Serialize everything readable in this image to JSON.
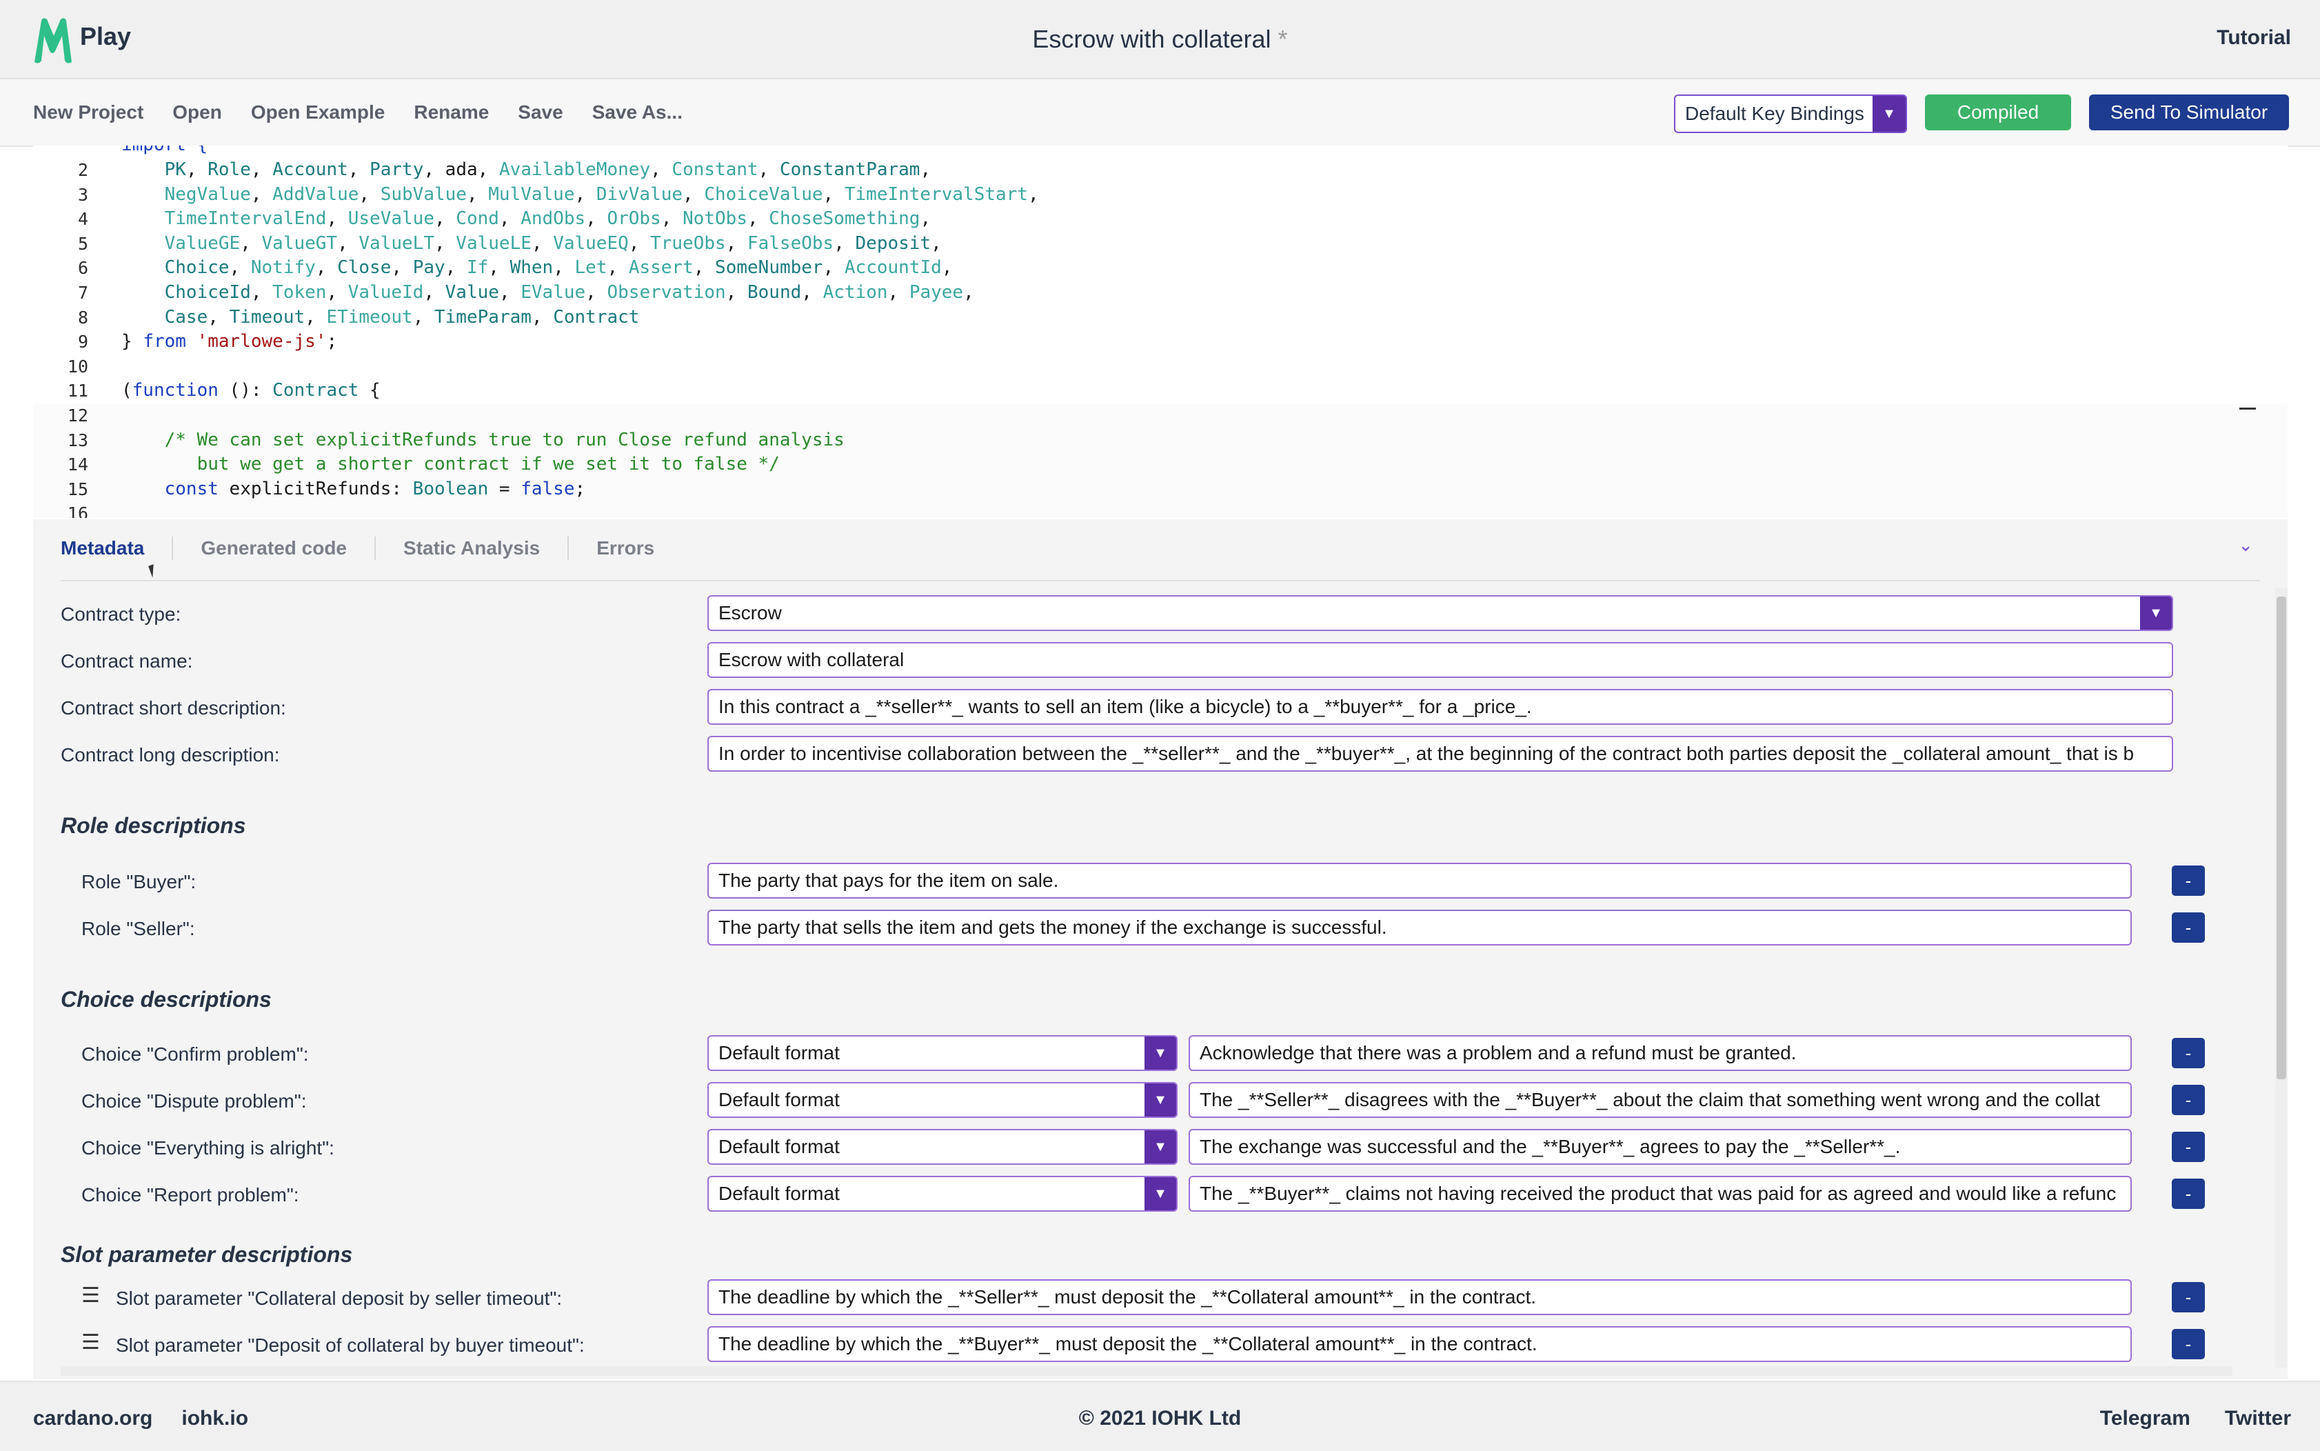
{
  "app": {
    "logo_text": "Play",
    "title": "Escrow with collateral",
    "dirty_marker": "*",
    "tutorial": "Tutorial"
  },
  "toolbar": {
    "menu": [
      "New Project",
      "Open",
      "Open Example",
      "Rename",
      "Save",
      "Save As..."
    ],
    "key_bindings": "Default Key Bindings",
    "compiled": "Compiled",
    "send": "Send To Simulator"
  },
  "editor": {
    "lines": [
      {
        "n": "2",
        "tokens": [
          [
            "pl",
            "    "
          ],
          [
            "ty",
            "PK"
          ],
          [
            "pl",
            ", "
          ],
          [
            "ty",
            "Role"
          ],
          [
            "pl",
            ", "
          ],
          [
            "ty",
            "Account"
          ],
          [
            "pl",
            ", "
          ],
          [
            "ty",
            "Party"
          ],
          [
            "pl",
            ", "
          ],
          [
            "pl",
            "ada"
          ],
          [
            "pl",
            ", "
          ],
          [
            "dim",
            "AvailableMoney"
          ],
          [
            "pl",
            ", "
          ],
          [
            "dim",
            "Constant"
          ],
          [
            "pl",
            ", "
          ],
          [
            "ty",
            "ConstantParam"
          ],
          [
            "pl",
            ","
          ]
        ]
      },
      {
        "n": "3",
        "tokens": [
          [
            "pl",
            "    "
          ],
          [
            "dim",
            "NegValue"
          ],
          [
            "pl",
            ", "
          ],
          [
            "dim",
            "AddValue"
          ],
          [
            "pl",
            ", "
          ],
          [
            "dim",
            "SubValue"
          ],
          [
            "pl",
            ", "
          ],
          [
            "dim",
            "MulValue"
          ],
          [
            "pl",
            ", "
          ],
          [
            "dim",
            "DivValue"
          ],
          [
            "pl",
            ", "
          ],
          [
            "dim",
            "ChoiceValue"
          ],
          [
            "pl",
            ", "
          ],
          [
            "dim",
            "TimeIntervalStart"
          ],
          [
            "pl",
            ","
          ]
        ]
      },
      {
        "n": "4",
        "tokens": [
          [
            "pl",
            "    "
          ],
          [
            "dim",
            "TimeIntervalEnd"
          ],
          [
            "pl",
            ", "
          ],
          [
            "dim",
            "UseValue"
          ],
          [
            "pl",
            ", "
          ],
          [
            "dim",
            "Cond"
          ],
          [
            "pl",
            ", "
          ],
          [
            "dim",
            "AndObs"
          ],
          [
            "pl",
            ", "
          ],
          [
            "dim",
            "OrObs"
          ],
          [
            "pl",
            ", "
          ],
          [
            "dim",
            "NotObs"
          ],
          [
            "pl",
            ", "
          ],
          [
            "dim",
            "ChoseSomething"
          ],
          [
            "pl",
            ","
          ]
        ]
      },
      {
        "n": "5",
        "tokens": [
          [
            "pl",
            "    "
          ],
          [
            "dim",
            "ValueGE"
          ],
          [
            "pl",
            ", "
          ],
          [
            "dim",
            "ValueGT"
          ],
          [
            "pl",
            ", "
          ],
          [
            "dim",
            "ValueLT"
          ],
          [
            "pl",
            ", "
          ],
          [
            "dim",
            "ValueLE"
          ],
          [
            "pl",
            ", "
          ],
          [
            "dim",
            "ValueEQ"
          ],
          [
            "pl",
            ", "
          ],
          [
            "dim",
            "TrueObs"
          ],
          [
            "pl",
            ", "
          ],
          [
            "dim",
            "FalseObs"
          ],
          [
            "pl",
            ", "
          ],
          [
            "ty",
            "Deposit"
          ],
          [
            "pl",
            ","
          ]
        ]
      },
      {
        "n": "6",
        "tokens": [
          [
            "pl",
            "    "
          ],
          [
            "ty",
            "Choice"
          ],
          [
            "pl",
            ", "
          ],
          [
            "dim",
            "Notify"
          ],
          [
            "pl",
            ", "
          ],
          [
            "ty",
            "Close"
          ],
          [
            "pl",
            ", "
          ],
          [
            "ty",
            "Pay"
          ],
          [
            "pl",
            ", "
          ],
          [
            "dim",
            "If"
          ],
          [
            "pl",
            ", "
          ],
          [
            "ty",
            "When"
          ],
          [
            "pl",
            ", "
          ],
          [
            "dim",
            "Let"
          ],
          [
            "pl",
            ", "
          ],
          [
            "dim",
            "Assert"
          ],
          [
            "pl",
            ", "
          ],
          [
            "ty",
            "SomeNumber"
          ],
          [
            "pl",
            ", "
          ],
          [
            "dim",
            "AccountId"
          ],
          [
            "pl",
            ","
          ]
        ]
      },
      {
        "n": "7",
        "tokens": [
          [
            "pl",
            "    "
          ],
          [
            "ty",
            "ChoiceId"
          ],
          [
            "pl",
            ", "
          ],
          [
            "dim",
            "Token"
          ],
          [
            "pl",
            ", "
          ],
          [
            "dim",
            "ValueId"
          ],
          [
            "pl",
            ", "
          ],
          [
            "ty",
            "Value"
          ],
          [
            "pl",
            ", "
          ],
          [
            "dim",
            "EValue"
          ],
          [
            "pl",
            ", "
          ],
          [
            "dim",
            "Observation"
          ],
          [
            "pl",
            ", "
          ],
          [
            "ty",
            "Bound"
          ],
          [
            "pl",
            ", "
          ],
          [
            "dim",
            "Action"
          ],
          [
            "pl",
            ", "
          ],
          [
            "dim",
            "Payee"
          ],
          [
            "pl",
            ","
          ]
        ]
      },
      {
        "n": "8",
        "tokens": [
          [
            "pl",
            "    "
          ],
          [
            "ty",
            "Case"
          ],
          [
            "pl",
            ", "
          ],
          [
            "ty",
            "Timeout"
          ],
          [
            "pl",
            ", "
          ],
          [
            "dim",
            "ETimeout"
          ],
          [
            "pl",
            ", "
          ],
          [
            "ty",
            "TimeParam"
          ],
          [
            "pl",
            ", "
          ],
          [
            "ty",
            "Contract"
          ]
        ]
      },
      {
        "n": "9",
        "tokens": [
          [
            "pl",
            "} "
          ],
          [
            "kw",
            "from"
          ],
          [
            "pl",
            " "
          ],
          [
            "str",
            "'marlowe-js'"
          ],
          [
            "pl",
            ";"
          ]
        ]
      },
      {
        "n": "10",
        "tokens": []
      },
      {
        "n": "11",
        "tokens": [
          [
            "pl",
            "("
          ],
          [
            "kw",
            "function"
          ],
          [
            "pl",
            " (): "
          ],
          [
            "ty",
            "Contract"
          ],
          [
            "pl",
            " {"
          ]
        ]
      },
      {
        "n": "12",
        "tokens": [],
        "hl": true
      },
      {
        "n": "13",
        "tokens": [
          [
            "pl",
            "    "
          ],
          [
            "com",
            "/* We can set explicitRefunds true to run Close refund analysis"
          ]
        ],
        "hl": true
      },
      {
        "n": "14",
        "tokens": [
          [
            "com",
            "       but we get a shorter contract if we set it to false */"
          ]
        ],
        "hl": true
      },
      {
        "n": "15",
        "tokens": [
          [
            "pl",
            "    "
          ],
          [
            "kw",
            "const"
          ],
          [
            "pl",
            " explicitRefunds: "
          ],
          [
            "ty",
            "Boolean"
          ],
          [
            "pl",
            " = "
          ],
          [
            "kw",
            "false"
          ],
          [
            "pl",
            ";"
          ]
        ],
        "hl": true
      },
      {
        "n": "16",
        "tokens": [],
        "hl": true
      }
    ]
  },
  "tabs": [
    "Metadata",
    "Generated code",
    "Static Analysis",
    "Errors"
  ],
  "metadata": {
    "contract_type_label": "Contract type:",
    "contract_type": "Escrow",
    "contract_name_label": "Contract name:",
    "contract_name": "Escrow with collateral",
    "short_desc_label": "Contract short description:",
    "short_desc": "In this contract a _**seller**_ wants to sell an item (like a bicycle) to a _**buyer**_ for a _price_.",
    "long_desc_label": "Contract long description:",
    "long_desc": "In order to incentivise collaboration between the _**seller**_ and the _**buyer**_, at the beginning of the contract both parties deposit the _collateral amount_ that is b",
    "role_section": "Role descriptions",
    "roles": [
      {
        "label": "Role \"Buyer\":",
        "value": "The party that pays for the item on sale."
      },
      {
        "label": "Role \"Seller\":",
        "value": "The party that sells the item and gets the money if the exchange is successful."
      }
    ],
    "choice_section": "Choice descriptions",
    "choices": [
      {
        "label": "Choice \"Confirm problem\":",
        "format": "Default format",
        "value": "Acknowledge that there was a problem and a refund must be granted."
      },
      {
        "label": "Choice \"Dispute problem\":",
        "format": "Default format",
        "value": "The _**Seller**_ disagrees with the _**Buyer**_ about the claim that something went wrong and the collat"
      },
      {
        "label": "Choice \"Everything is alright\":",
        "format": "Default format",
        "value": "The exchange was successful and the _**Buyer**_ agrees to pay the _**Seller**_."
      },
      {
        "label": "Choice \"Report problem\":",
        "format": "Default format",
        "value": "The _**Buyer**_ claims not having received the product that was paid for as agreed and would like a refunc"
      }
    ],
    "slot_section": "Slot parameter descriptions",
    "slots": [
      {
        "label": "Slot parameter \"Collateral deposit by seller timeout\":",
        "value": "The deadline by which the _**Seller**_ must deposit the _**Collateral amount**_ in the contract."
      },
      {
        "label": "Slot parameter \"Deposit of collateral by buyer timeout\":",
        "value": "The deadline by which the _**Buyer**_ must deposit the _**Collateral amount**_ in the contract."
      }
    ],
    "remove_label": "-"
  },
  "footer": {
    "left": [
      "cardano.org",
      "iohk.io"
    ],
    "copyright": "© 2021 IOHK Ltd",
    "right": [
      "Telegram",
      "Twitter"
    ]
  },
  "colors": {
    "accent": "#5b2ea6",
    "primary": "#1d3b8f",
    "success": "#3bb368",
    "field_border": "#9b6fd8"
  },
  "icons": [
    "dropdown-arrow-icon",
    "chevron-down-icon",
    "drag-handle-icon",
    "logo-icon"
  ]
}
